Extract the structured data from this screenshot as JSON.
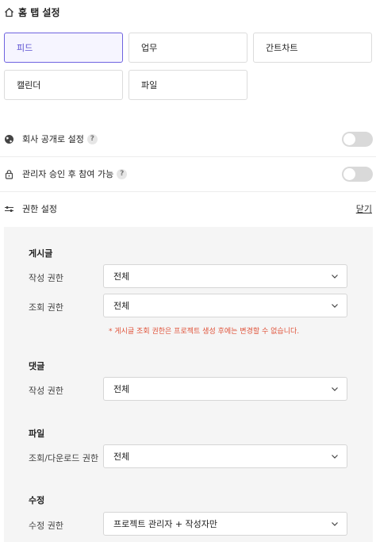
{
  "header": {
    "title": "홈 탭 설정",
    "icon": "home-icon"
  },
  "tabs": [
    {
      "label": "피드",
      "active": true
    },
    {
      "label": "업무",
      "active": false
    },
    {
      "label": "간트차트",
      "active": false
    },
    {
      "label": "캘린더",
      "active": false
    },
    {
      "label": "파일",
      "active": false
    }
  ],
  "settings": {
    "company_public": {
      "label": "회사 공개로 설정",
      "help": "?",
      "icon": "globe-icon",
      "enabled": false
    },
    "admin_approval": {
      "label": "관리자 승인 후 참여 가능",
      "help": "?",
      "icon": "lock-icon",
      "enabled": false
    }
  },
  "permissions": {
    "title": "권한 설정",
    "icon": "sliders-icon",
    "close_label": "닫기",
    "sections": {
      "post": {
        "title": "게시글",
        "write_label": "작성 권한",
        "write_value": "전체",
        "view_label": "조회 권한",
        "view_value": "전체",
        "note": "* 게시글 조회 권한은 프로젝트 생성 후에는 변경할 수 없습니다."
      },
      "comment": {
        "title": "댓글",
        "write_label": "작성 권한",
        "write_value": "전체"
      },
      "file": {
        "title": "파일",
        "download_label": "조회/다운로드 권한",
        "download_value": "전체"
      },
      "edit": {
        "title": "수정",
        "edit_label": "수정 권한",
        "edit_value": "프로젝트 관리자 + 작성자만"
      }
    }
  },
  "colors": {
    "accent": "#6f63e0",
    "note": "#e0533a",
    "toggle_off": "#d9d9d9"
  }
}
